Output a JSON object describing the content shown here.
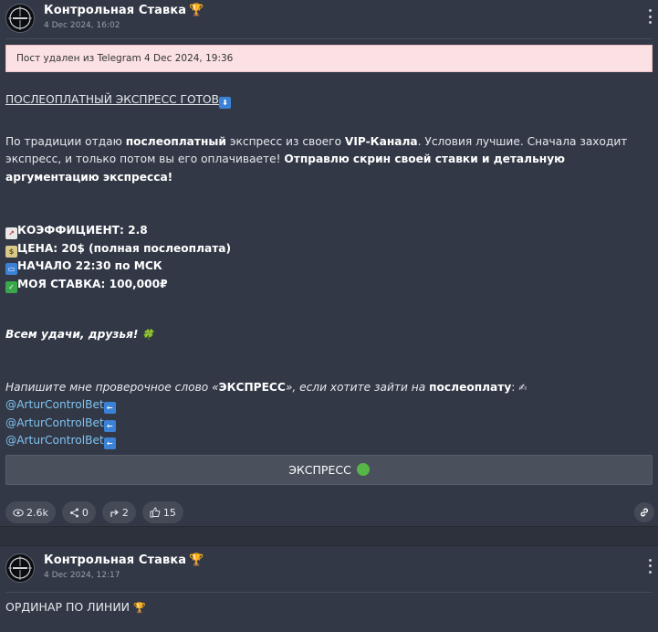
{
  "post1": {
    "channel": "Контрольная Ставка",
    "trophy": "🏆",
    "date": "4 Dec 2024, 16:02",
    "deleted_notice_prefix": "Пост удален из Telegram",
    "deleted_notice_date": "4 Dec 2024, 19:36",
    "title": "ПОСЛЕОПЛАТНЫЙ ЭКСПРЕСС ГОТОВ",
    "title_emoji": "⬇",
    "intro": {
      "t1": "По традиции отдаю ",
      "b1": "послеоплатный",
      "t2": " экспресс из своего ",
      "b2": "VIP-Канала",
      "t3": ". Условия лучшие. Сначала заходит экспресс, и только потом вы его оплачиваете! ",
      "b3": "Отправлю скрин своей ставки и детальную аргументацию экспресса!"
    },
    "stats_lines": [
      {
        "icon": "📈",
        "text": "КОЭФФИЦИЕНТ: 2.8"
      },
      {
        "icon": "$",
        "text": "ЦЕНА: 20$ (полная послеоплата)"
      },
      {
        "icon": "▭",
        "text": "НАЧАЛО 22:30 по МСК"
      },
      {
        "icon": "✓",
        "text": "МОЯ СТАВКА: 100,000₽"
      }
    ],
    "wish": "Всем удачи, друзья!",
    "wish_emoji": "🍀",
    "cta": {
      "t1": "Напишите мне проверочное слово «",
      "b1": "ЭКСПРЕСС",
      "t2": "», если хотите зайти на ",
      "b2": "послеоплату",
      "t3": ":",
      "emoji": "✍"
    },
    "links": [
      "@ArturControlBet",
      "@ArturControlBet",
      "@ArturControlBet"
    ],
    "link_arrow": "←",
    "button_label": "ЭКСПРЕСС",
    "views": "2.6k",
    "shares": "0",
    "forwards": "2",
    "likes": "15"
  },
  "post2": {
    "channel": "Контрольная Ставка",
    "trophy": "🏆",
    "date": "4 Dec 2024, 12:17",
    "title": "ОРДИНАР ПО ЛИНИИ",
    "title_emoji": "🏆"
  },
  "colors": {
    "background": "#323846",
    "link": "#7fc3f0",
    "deleted_bg": "#fbe1e3",
    "button_bg": "#4a505c"
  }
}
